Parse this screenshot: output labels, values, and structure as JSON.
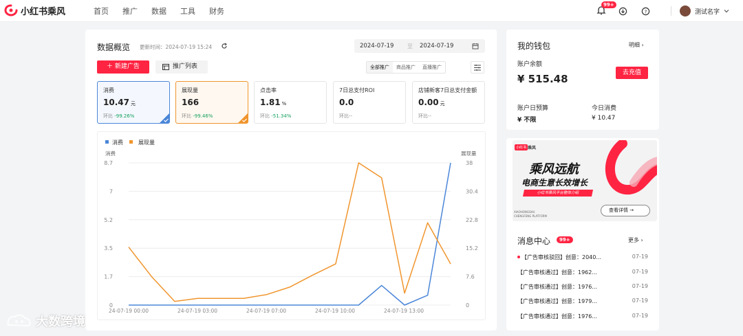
{
  "brand": {
    "name": "小红书乘风"
  },
  "nav": {
    "items": [
      "首页",
      "推广",
      "数据",
      "工具",
      "财务"
    ]
  },
  "header": {
    "notif_badge": "99+",
    "user_name": "测试名字"
  },
  "overview": {
    "title": "数据概览",
    "updated": "更新时间：2024-07-19 15:24",
    "date_start": "2024-07-19",
    "date_sep": "至",
    "date_end": "2024-07-19",
    "new_ad_btn": "＋ 新建广告",
    "list_btn": "推广列表",
    "seg": [
      "全部推广",
      "商品推广",
      "直播推广"
    ]
  },
  "kpis": [
    {
      "title": "消费",
      "value": "10.47",
      "unit": "元",
      "change_label": "环比",
      "change": "-99.26%"
    },
    {
      "title": "展现量",
      "value": "166",
      "unit": "",
      "change_label": "环比",
      "change": "-99.46%"
    },
    {
      "title": "点击率",
      "value": "1.81",
      "unit": "%",
      "change_label": "环比",
      "change": "-51.34%"
    },
    {
      "title": "7日总支付ROI",
      "value": "0.0",
      "unit": "",
      "change_label": "环比",
      "change": "--"
    },
    {
      "title": "店铺新客7日总支付金额",
      "value": "0.00",
      "unit": "元",
      "change_label": "环比",
      "change": "--"
    }
  ],
  "chart_data": {
    "type": "line",
    "legend": [
      "消费",
      "展现量"
    ],
    "y_left_label": "消费",
    "y_right_label": "展现量",
    "y_left_ticks": [
      "8.7",
      "7",
      "5.2",
      "3.5",
      "1.7",
      "0"
    ],
    "y_right_ticks": [
      "38",
      "30.4",
      "22.8",
      "15.2",
      "7.6",
      "0"
    ],
    "x_ticks": [
      "24-07-19 00:00",
      "24-07-19 03:00",
      "24-07-19 07:00",
      "24-07-19 10:00",
      "24-07-19 13:00"
    ],
    "ylim_left": [
      0,
      8.7
    ],
    "ylim_right": [
      0,
      38
    ],
    "colors": {
      "spend": "#4a86d8",
      "impressions": "#f0952d"
    },
    "series": [
      {
        "name": "消费",
        "axis": "left",
        "values": [
          0,
          0,
          0,
          0,
          0,
          0,
          0,
          0,
          0,
          0,
          0,
          1.2,
          0,
          0.6,
          8.7
        ]
      },
      {
        "name": "展现量",
        "axis": "right",
        "values": [
          15.5,
          7.6,
          1,
          1.8,
          1.8,
          1.8,
          2.8,
          4.8,
          8,
          11,
          38,
          34,
          3.2,
          22,
          11
        ]
      }
    ]
  },
  "wallet": {
    "title": "我的钱包",
    "detail": "明细",
    "balance_label": "账户余额",
    "balance": "¥ 515.48",
    "recharge": "去充值",
    "budget_label": "账户日预算",
    "budget": "¥ 不限",
    "today_label": "今日消费",
    "today": "¥ 10.47"
  },
  "banner": {
    "tag1": "小红书",
    "tag2": "乘风",
    "title": "乘风远航",
    "subtitle": "电商生意长效增长",
    "pill": "小红书乘风平台整体介绍",
    "en1": "XIAOHONGSHU",
    "en2": "CHENGFENG PLATFORM",
    "btn": "查看详情"
  },
  "messages": {
    "title": "消息中心",
    "badge": "99+",
    "more": "更多",
    "items": [
      {
        "text": "【广告审核驳回】创意：2040...",
        "date": "07-19"
      },
      {
        "text": "【广告审核通过】创意：1962...",
        "date": "07-19"
      },
      {
        "text": "【广告审核通过】创意：1976...",
        "date": "07-19"
      },
      {
        "text": "【广告审核通过】创意：1979...",
        "date": "07-19"
      },
      {
        "text": "【广告审核通过】创意：1976...",
        "date": "07-19"
      }
    ]
  },
  "watermark": "大数跨境",
  "colors": {
    "brand": "#ff2442",
    "positive": "#13a05d"
  }
}
